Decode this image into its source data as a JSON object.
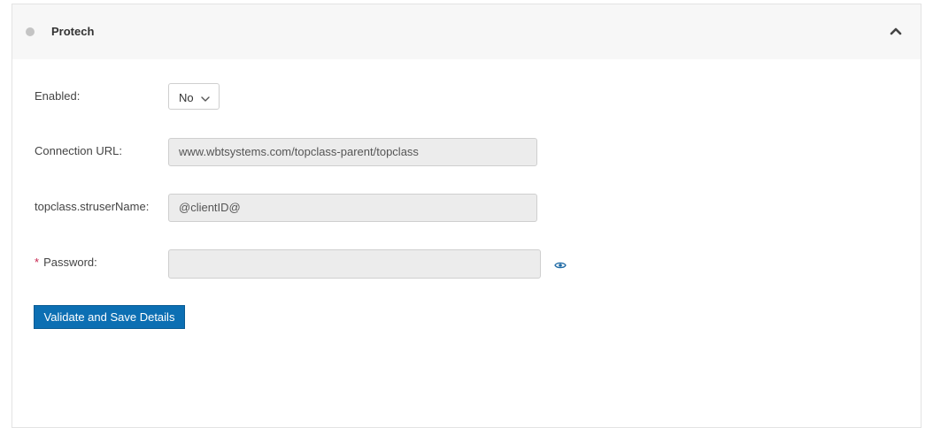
{
  "panel": {
    "title": "Protech",
    "status_color": "#c4c4c4"
  },
  "form": {
    "enabled": {
      "label": "Enabled:",
      "value": "No"
    },
    "connection_url": {
      "label": "Connection URL:",
      "value": "www.wbtsystems.com/topclass-parent/topclass"
    },
    "struser_name": {
      "label": "topclass.struserName:",
      "value": "@clientID@"
    },
    "password": {
      "required_marker": "*",
      "label": "Password:",
      "value": ""
    }
  },
  "actions": {
    "save_label": "Validate and Save Details"
  },
  "icons": {
    "collapse": "chevron-up-icon",
    "select": "chevron-down-icon",
    "reveal": "eye-icon"
  },
  "colors": {
    "primary": "#0c6fb3",
    "required": "#c7254e",
    "field_bg": "#ececec"
  }
}
